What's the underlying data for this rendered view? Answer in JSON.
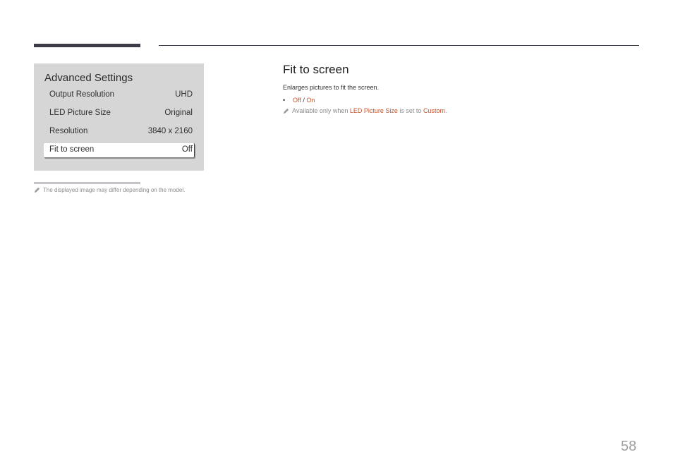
{
  "panel": {
    "title": "Advanced Settings",
    "rows": [
      {
        "label": "Output Resolution",
        "value": "UHD"
      },
      {
        "label": "LED Picture Size",
        "value": "Original"
      },
      {
        "label": "Resolution",
        "value": "3840 x 2160"
      },
      {
        "label": "Fit to screen",
        "value": "Off",
        "selected": true
      }
    ]
  },
  "footnote": {
    "icon": "pencil-icon",
    "text": "The displayed image may differ depending on the model."
  },
  "section": {
    "title": "Fit to screen",
    "description": "Enlarges pictures to fit the screen.",
    "options": {
      "bullet": "•",
      "off": "Off",
      "separator": " / ",
      "on": "On"
    },
    "note": {
      "icon": "pencil-icon",
      "prefix": "Available only when ",
      "highlight1": "LED Picture Size",
      "middle": " is set to ",
      "highlight2": "Custom",
      "suffix": "."
    }
  },
  "accent_color": "#c1502a",
  "page_number": "58"
}
